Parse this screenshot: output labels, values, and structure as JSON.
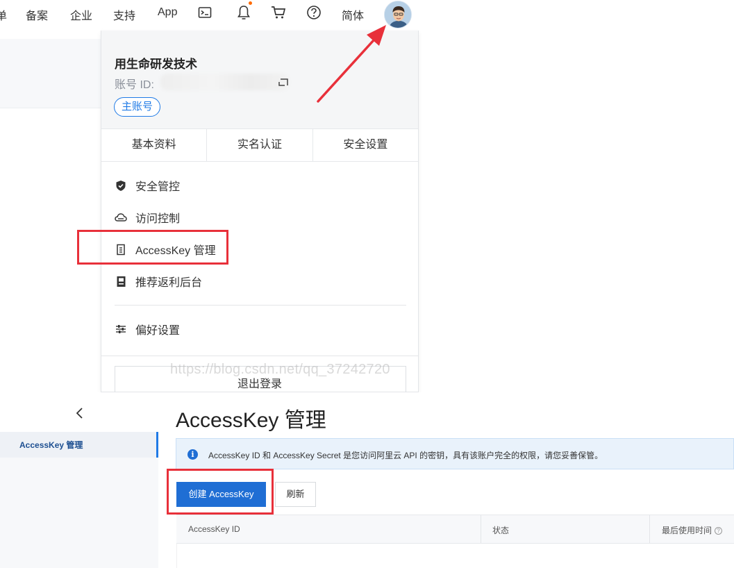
{
  "topnav": {
    "partial_left": "单",
    "items": [
      "备案",
      "企业",
      "支持",
      "App"
    ],
    "lang": "简体",
    "icons": [
      "terminal-icon",
      "bell-icon",
      "cart-icon",
      "help-icon"
    ],
    "notification_dot_color": "#ff6a00"
  },
  "account_menu": {
    "user_name": "用生命研发技术",
    "account_id_label": "账号 ID:",
    "badge": "主账号",
    "tabs": [
      "基本资料",
      "实名认证",
      "安全设置"
    ],
    "items": [
      {
        "label": "安全管控",
        "icon": "shield-icon"
      },
      {
        "label": "访问控制",
        "icon": "cloud-icon"
      },
      {
        "label": "AccessKey 管理",
        "icon": "key-box-icon"
      },
      {
        "label": "推荐返利后台",
        "icon": "document-icon"
      }
    ],
    "preferences": "偏好设置",
    "logout": "退出登录",
    "watermark": "https://blog.csdn.net/qq_37242720"
  },
  "console": {
    "sidebar_item": "AccessKey 管理",
    "page_title": "AccessKey 管理",
    "notice": "AccessKey ID 和 AccessKey Secret 是您访问阿里云 API 的密钥，具有该账户完全的权限，请您妥善保管。",
    "create_button": "创建 AccessKey",
    "refresh_button": "刷新",
    "table_headers": [
      "AccessKey ID",
      "状态",
      "最后使用时间"
    ]
  },
  "colors": {
    "accent": "#1f6ed4",
    "highlight": "#e8303a"
  }
}
